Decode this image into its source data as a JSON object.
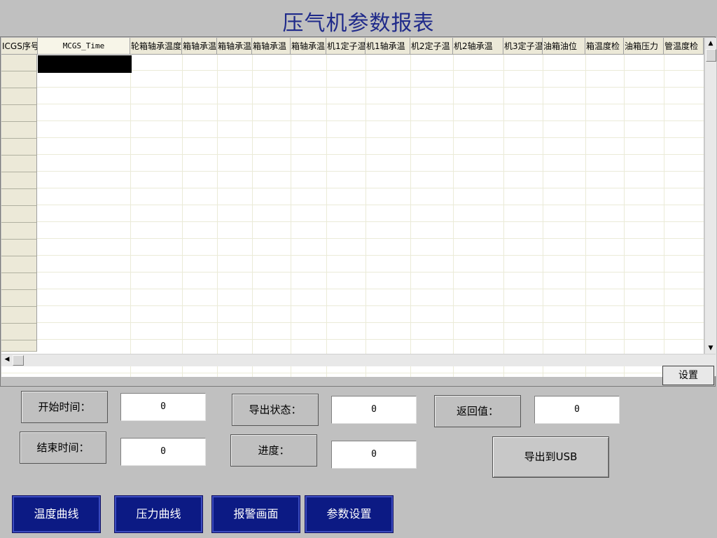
{
  "title": "压气机参数报表",
  "table": {
    "headers": [
      "ICGS序号",
      "MCGS_Time",
      "轮箱轴承温度",
      "箱轴承温",
      "箱轴承温",
      "箱轴承温",
      "箱轴承温",
      "机1定子温",
      "机1轴承温",
      "机2定子温",
      "机2轴承温",
      "机3定子温",
      "油箱油位",
      "箱温度检",
      "油箱压力",
      "管温度检"
    ]
  },
  "scroll": {
    "up": "▲",
    "down": "▼",
    "left": "◀"
  },
  "settings_button": "设置",
  "form": {
    "start_time_label": "开始时间：",
    "start_time_value": "0",
    "end_time_label": "结束时间：",
    "end_time_value": "0",
    "export_status_label": "导出状态：",
    "export_status_value": "0",
    "progress_label": "进度：",
    "progress_value": "0",
    "return_value_label": "返回值：",
    "return_value_value": "0",
    "export_usb_button": "导出到USB"
  },
  "nav": {
    "temperature_curve": "温度曲线",
    "pressure_curve": "压力曲线",
    "alarm_screen": "报警画面",
    "parameter_settings": "参数设置"
  },
  "colors": {
    "nav_bg": "#0c1a84",
    "title": "#1f2a8a",
    "header_bg": "#ece9d8"
  }
}
